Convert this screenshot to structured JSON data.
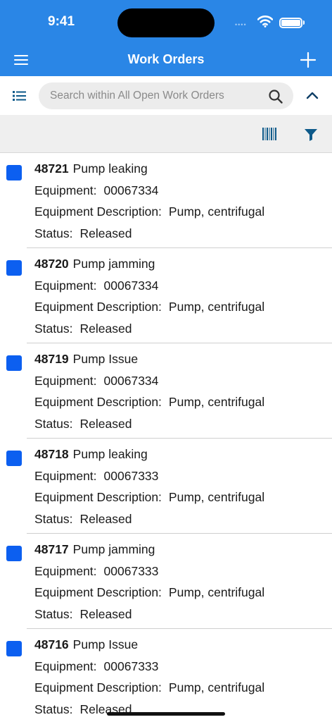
{
  "status_bar": {
    "time": "9:41",
    "signal": "••••"
  },
  "header": {
    "title": "Work Orders"
  },
  "search": {
    "placeholder": "Search within All Open Work Orders"
  },
  "labels": {
    "equipment": "Equipment:",
    "equipment_description": "Equipment Description:",
    "status": "Status:"
  },
  "colors": {
    "header": "#2a86e6",
    "accent": "#0c5ff0",
    "icon": "#0e5a8a"
  },
  "icons": {
    "menu": "menu-icon",
    "add": "plus-icon",
    "list_view": "list-icon",
    "search": "search-icon",
    "collapse": "chevron-up-icon",
    "barcode": "barcode-icon",
    "filter": "filter-icon"
  },
  "work_orders": [
    {
      "number": "48721",
      "title": "Pump leaking",
      "equipment": "00067334",
      "equipment_description": "Pump, centrifugal",
      "status": "Released"
    },
    {
      "number": "48720",
      "title": "Pump jamming",
      "equipment": "00067334",
      "equipment_description": "Pump, centrifugal",
      "status": "Released"
    },
    {
      "number": "48719",
      "title": "Pump Issue",
      "equipment": "00067334",
      "equipment_description": "Pump, centrifugal",
      "status": "Released"
    },
    {
      "number": "48718",
      "title": "Pump leaking",
      "equipment": "00067333",
      "equipment_description": "Pump, centrifugal",
      "status": "Released"
    },
    {
      "number": "48717",
      "title": "Pump jamming",
      "equipment": "00067333",
      "equipment_description": "Pump, centrifugal",
      "status": "Released"
    },
    {
      "number": "48716",
      "title": "Pump Issue",
      "equipment": "00067333",
      "equipment_description": "Pump, centrifugal",
      "status": "Released"
    }
  ]
}
